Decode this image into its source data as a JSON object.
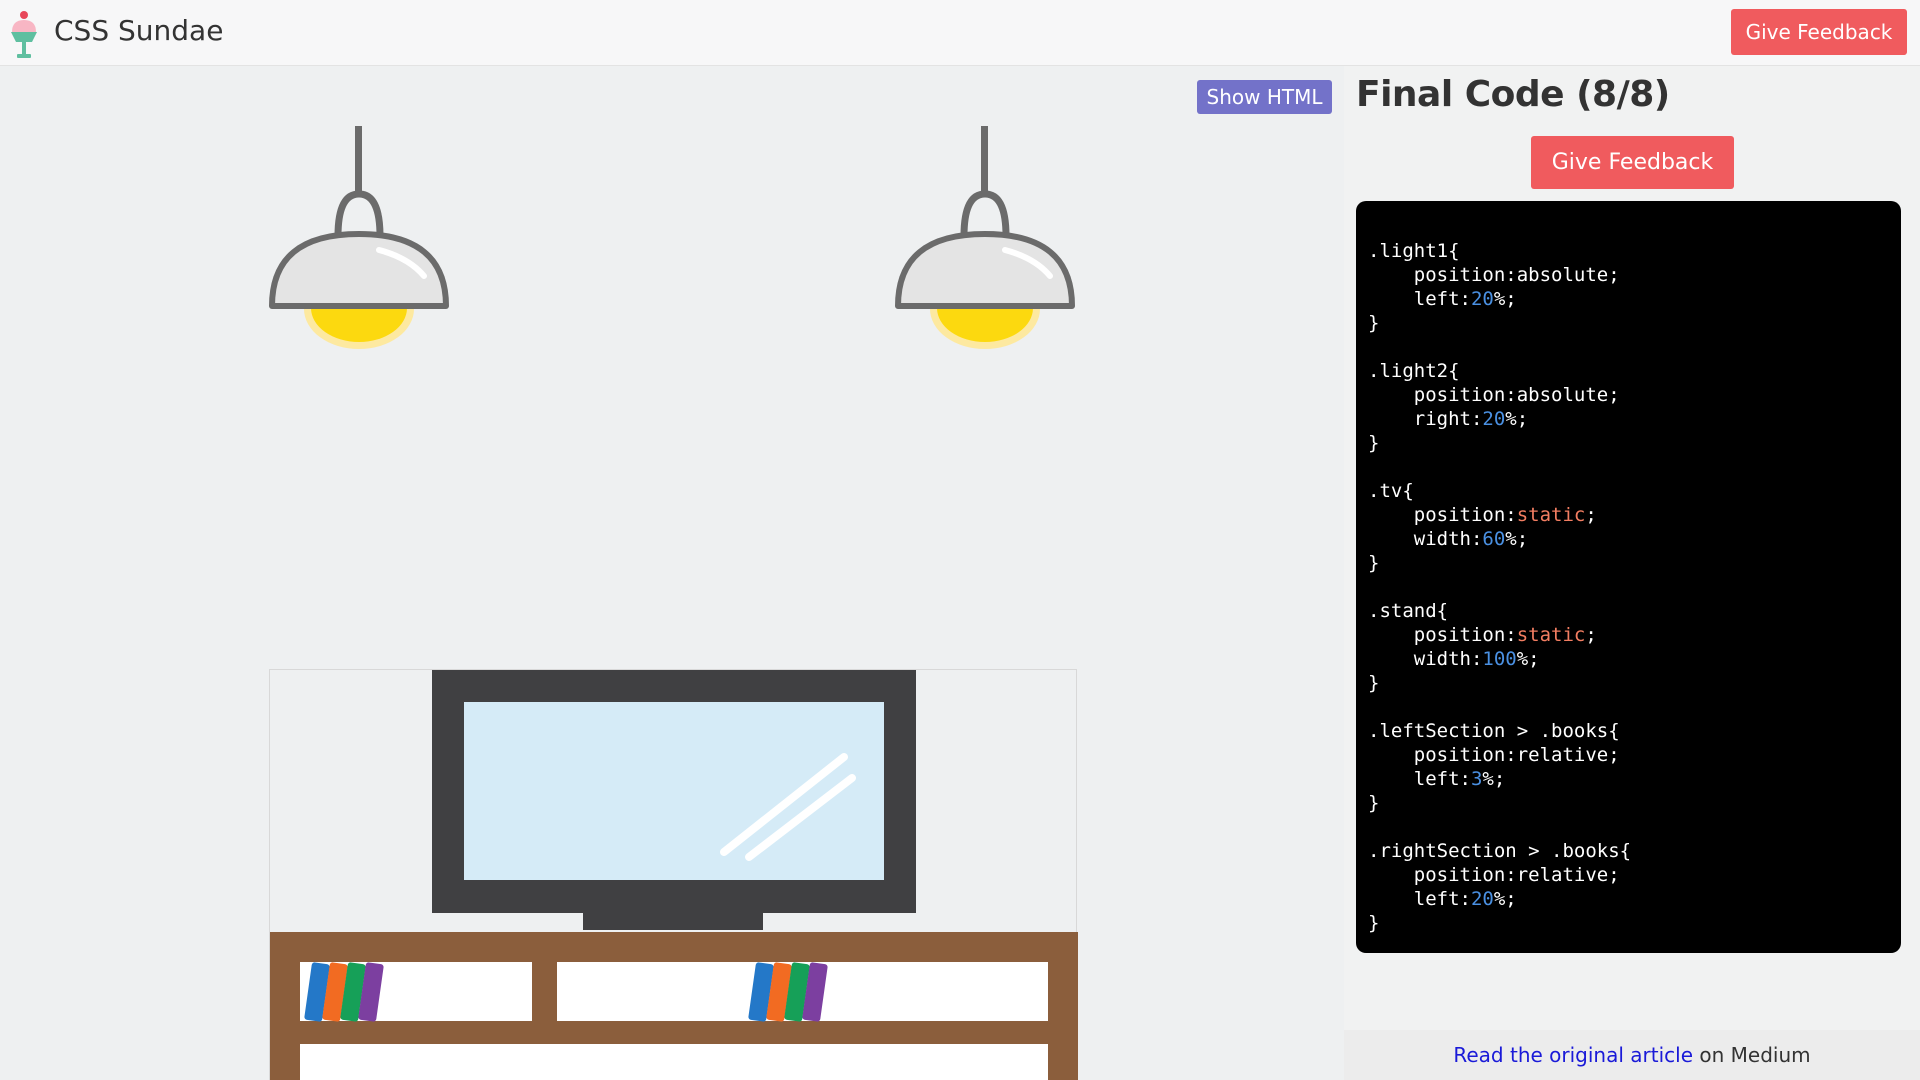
{
  "header": {
    "title": "CSS Sundae",
    "feedback_label": "Give Feedback"
  },
  "scene": {
    "show_html_label": "Show HTML"
  },
  "panel": {
    "title": "Final Code (8/8)",
    "feedback_label": "Give Feedback",
    "code": [
      {
        "selector": ".light1{",
        "props": [
          {
            "name": "    position:",
            "value": "absolute",
            "suffix": ";",
            "kind": "plain"
          },
          {
            "name": "    left:",
            "value": "20",
            "suffix": "%;",
            "kind": "num"
          }
        ]
      },
      {
        "selector": ".light2{",
        "props": [
          {
            "name": "    position:",
            "value": "absolute",
            "suffix": ";",
            "kind": "plain"
          },
          {
            "name": "    right:",
            "value": "20",
            "suffix": "%;",
            "kind": "num"
          }
        ]
      },
      {
        "selector": ".tv{",
        "props": [
          {
            "name": "    position:",
            "value": "static",
            "suffix": ";",
            "kind": "kw"
          },
          {
            "name": "    width:",
            "value": "60",
            "suffix": "%;",
            "kind": "num"
          }
        ]
      },
      {
        "selector": ".stand{",
        "props": [
          {
            "name": "    position:",
            "value": "static",
            "suffix": ";",
            "kind": "kw"
          },
          {
            "name": "    width:",
            "value": "100",
            "suffix": "%;",
            "kind": "num"
          }
        ]
      },
      {
        "selector": ".leftSection > .books{",
        "props": [
          {
            "name": "    position:",
            "value": "relative",
            "suffix": ";",
            "kind": "plain"
          },
          {
            "name": "    left:",
            "value": "3",
            "suffix": "%;",
            "kind": "num"
          }
        ]
      },
      {
        "selector": ".rightSection > .books{",
        "props": [
          {
            "name": "    position:",
            "value": "relative",
            "suffix": ";",
            "kind": "plain"
          },
          {
            "name": "    left:",
            "value": "20",
            "suffix": "%;",
            "kind": "num"
          }
        ]
      }
    ],
    "closing_brace": "}"
  },
  "footer": {
    "link_text": "Read the original article",
    "suffix": " on Medium"
  },
  "colors": {
    "accent_red": "#f05b5e",
    "show_html_purple": "#7372c9",
    "code_number": "#4a90e2",
    "code_keyword": "#f37e62",
    "book_blue": "#2478c8",
    "book_orange": "#f26b22",
    "book_green": "#16a058",
    "book_purple": "#7c3fa0"
  }
}
